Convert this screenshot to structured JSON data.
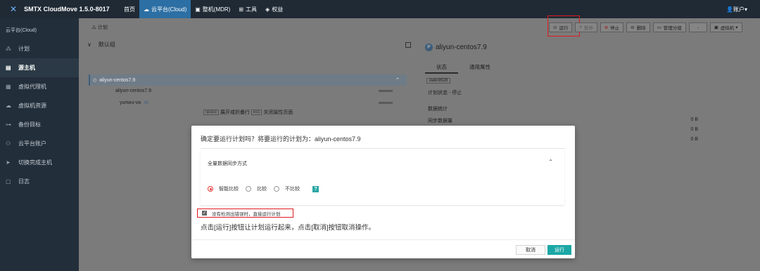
{
  "app": {
    "title": "SMTX CloudMove 1.5.0-8017"
  },
  "nav": [
    {
      "label": "首页"
    },
    {
      "label": "云平台(Cloud)"
    },
    {
      "label": "整机(MDR)"
    },
    {
      "label": "工具"
    },
    {
      "label": "权益"
    }
  ],
  "account": {
    "label": "账户"
  },
  "sidebar": {
    "title": "云平台(Cloud)",
    "items": [
      {
        "label": "计划",
        "icon": "sitemap-icon"
      },
      {
        "label": "源主机",
        "icon": "server-icon"
      },
      {
        "label": "虚拟代理机",
        "icon": "proxy-icon"
      },
      {
        "label": "虚拟机资源",
        "icon": "cloud-icon"
      },
      {
        "label": "备份目标",
        "icon": "target-icon"
      },
      {
        "label": "云平台账户",
        "icon": "users-icon"
      },
      {
        "label": "切换完成主机",
        "icon": "send-icon"
      },
      {
        "label": "日志",
        "icon": "log-icon"
      }
    ]
  },
  "left": {
    "crumb": "计划",
    "group": "默认组",
    "plan": "aliyun-centos7.9",
    "rows": [
      {
        "label": "aliyun-centos7.9"
      },
      {
        "label": "yunwu-va"
      }
    ],
    "hint": {
      "key1": "space",
      "text1": "展开或折叠行",
      "key2": "esc",
      "text2": "关闭属性页面"
    }
  },
  "toolbar": {
    "run": "运行",
    "pause": "暂停",
    "stop": "停止",
    "delete": "删除",
    "manage": "管理分组",
    "more": "-",
    "vm": "虚拟机"
  },
  "detail": {
    "title": "aliyun-centos7.9",
    "badge": "P",
    "tabs": [
      "状态",
      "通用属性"
    ],
    "tag": "da6c9528",
    "status_label": "计划状态 - 停止",
    "stats_title": "数据统计",
    "stats": [
      {
        "k": "同步数据量",
        "v": "0 B"
      },
      {
        "k": "",
        "v": "0 B"
      },
      {
        "k": "",
        "v": "0 B"
      }
    ]
  },
  "modal": {
    "title": "确定要运行计划吗？将要运行的计划为：aliyun-centos7.9",
    "section_title": "全量数据同步方式",
    "options": [
      "智能比较",
      "比较",
      "不比较"
    ],
    "selected_option": "智能比较",
    "help": "?",
    "checkbox_label": "没有检测出错误时，直接运行计划",
    "checkbox_checked": true,
    "info": "点击[运行]按钮让计划运行起来，点击[取消]按钮取消操作。",
    "cancel": "取消",
    "run": "运行"
  },
  "colors": {
    "primary": "#1aa7a5",
    "highlight": "#e0191e",
    "topbar": "#1f2a35",
    "sidebar": "#222e3a"
  }
}
